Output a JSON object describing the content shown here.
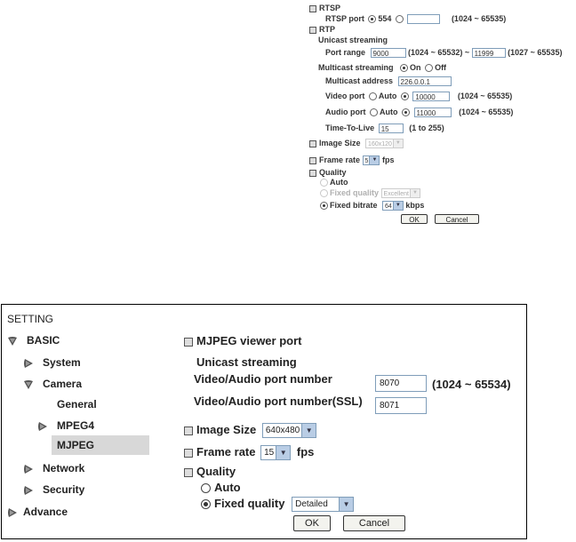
{
  "top": {
    "rtsp": {
      "heading": "RTSP",
      "port_label": "RTSP port",
      "port_default": "554",
      "port_custom_value": "",
      "port_range": "(1024 ~ 65535)"
    },
    "rtp": {
      "heading": "RTP",
      "unicast_label": "Unicast streaming",
      "port_range_label": "Port range",
      "port_from": "9000",
      "port_from_range": "(1024 ~ 65532) ~",
      "port_to": "11999",
      "port_to_range": "(1027 ~ 65535)",
      "multicast_label": "Multicast streaming",
      "on_label": "On",
      "off_label": "Off",
      "multicast_address_label": "Multicast address",
      "multicast_address": "226.0.0.1",
      "video_port_label": "Video port",
      "video_auto": "Auto",
      "video_port": "10000",
      "video_range": "(1024 ~ 65535)",
      "audio_port_label": "Audio port",
      "audio_auto": "Auto",
      "audio_port": "11000",
      "audio_range": "(1024 ~ 65535)",
      "ttl_label": "Time-To-Live",
      "ttl": "15",
      "ttl_range": "(1 to 255)"
    },
    "image_size": {
      "label": "Image Size",
      "value": "160x120"
    },
    "frame_rate": {
      "label": "Frame rate",
      "value": "5",
      "unit": "fps"
    },
    "quality": {
      "heading": "Quality",
      "auto_label": "Auto",
      "fixed_quality_label": "Fixed quality",
      "fixed_quality_value": "Excellent",
      "fixed_bitrate_label": "Fixed bitrate",
      "bitrate_value": "64",
      "bitrate_unit": "kbps"
    },
    "ok_label": "OK",
    "cancel_label": "Cancel"
  },
  "sidebar": {
    "title": "SETTING",
    "basic": "BASIC",
    "system": "System",
    "camera": "Camera",
    "general": "General",
    "mpeg4": "MPEG4",
    "mjpeg": "MJPEG",
    "network": "Network",
    "security": "Security",
    "advance": "Advance"
  },
  "mjpeg": {
    "viewer_port_heading": "MJPEG viewer port",
    "unicast_label": "Unicast streaming",
    "av_port_label": "Video/Audio port number",
    "av_port_value": "8070",
    "av_port_range": "(1024 ~ 65534)",
    "av_ssl_label": "Video/Audio port number(SSL)",
    "av_ssl_value": "8071",
    "image_size_label": "Image Size",
    "image_size_value": "640x480",
    "frame_rate_label": "Frame rate",
    "frame_rate_value": "15",
    "frame_rate_unit": "fps",
    "quality_heading": "Quality",
    "auto_label": "Auto",
    "fixed_quality_label": "Fixed quality",
    "fixed_quality_value": "Detailed",
    "ok_label": "OK",
    "cancel_label": "Cancel"
  }
}
